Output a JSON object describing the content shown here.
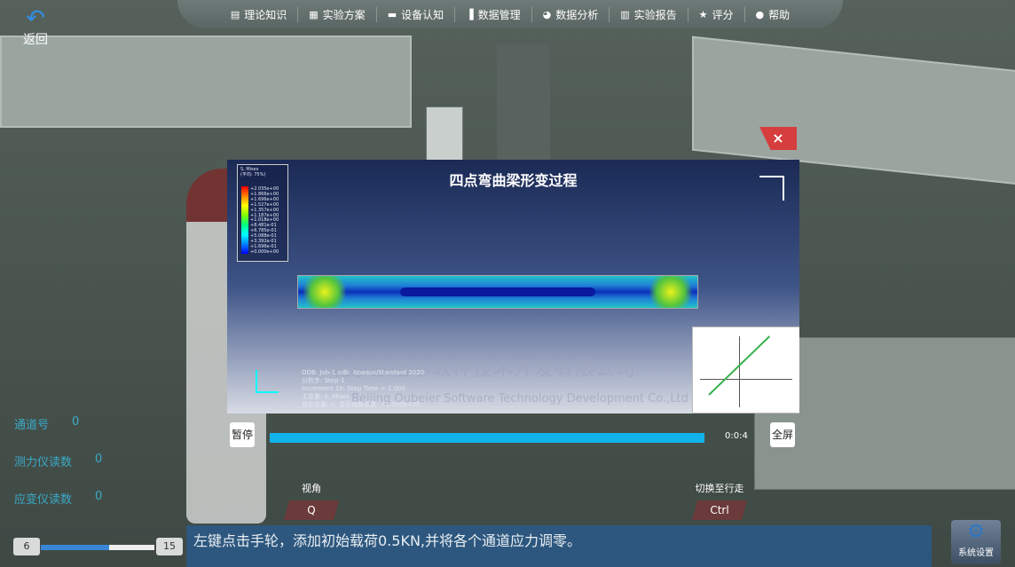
{
  "nav": {
    "back_label": "返回",
    "items": [
      {
        "icon": "book-icon",
        "label": "理论知识"
      },
      {
        "icon": "document-icon",
        "label": "实验方案"
      },
      {
        "icon": "device-icon",
        "label": "设备认知"
      },
      {
        "icon": "bar-chart-icon",
        "label": "数据管理"
      },
      {
        "icon": "pie-chart-icon",
        "label": "数据分析"
      },
      {
        "icon": "report-icon",
        "label": "实验报告"
      },
      {
        "icon": "star-icon",
        "label": "评分"
      },
      {
        "icon": "help-icon",
        "label": "帮助"
      }
    ]
  },
  "readouts": [
    {
      "label": "通道号",
      "value": "0"
    },
    {
      "label": "测力仪读数",
      "value": "0"
    },
    {
      "label": "应变仪读数",
      "value": "0"
    }
  ],
  "video": {
    "title": "四点弯曲梁形变过程",
    "close_label": "×",
    "legend_title": "S, Mises\n(平均: 75%)",
    "legend_values": [
      "+2.035e+00",
      "+1.866e+00",
      "+1.696e+00",
      "+1.527e+00",
      "+1.357e+00",
      "+1.187e+00",
      "+1.018e+00",
      "+8.481e-01",
      "+6.785e-01",
      "+5.088e-01",
      "+3.392e-01",
      "+1.696e-01",
      "+0.000e+00"
    ],
    "watermark_cn": "北京欧倍尔软件技术开发有限公司",
    "watermark_en": "Beijing Oubeier Software Technology Development Co.,Ltd",
    "info_text": "ODB: Job-1.odb  Abaqus/Standard 2020\n分析步: Step-1\nIncrement 10: Step Time = 1.000\n主变量: S, Mises\n变形变量: U  变形缩放系数: +1.000e+00"
  },
  "controls": {
    "pause_label": "暂停",
    "fullscreen_label": "全屏",
    "time": "0:0:4",
    "progress": 1.0
  },
  "hints": [
    {
      "label": "视角",
      "key": "Q"
    },
    {
      "label": "切换至行走",
      "key": "Ctrl"
    }
  ],
  "message": "左键点击手轮，添加初始载荷0.5KN,并将各个通道应力调零。",
  "slider": {
    "min": "6",
    "max": "15",
    "level": 0.6
  },
  "settings_label": "系统设置",
  "colors": {
    "accent": "#11b3ea",
    "close": "#d63d3d",
    "readout": "#3aa9c7"
  }
}
